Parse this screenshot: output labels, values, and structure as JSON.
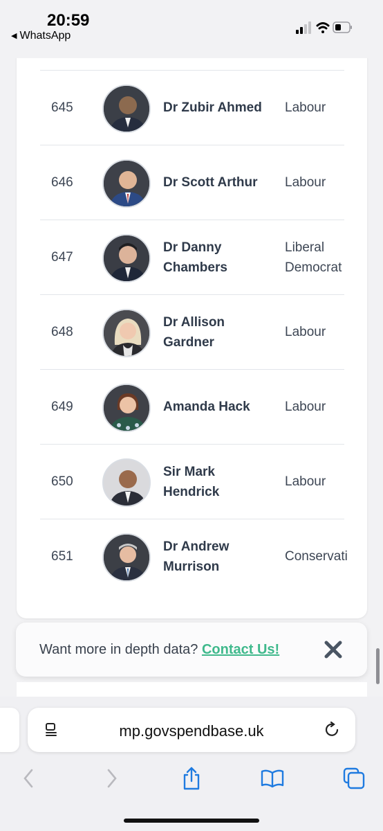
{
  "status_bar": {
    "time": "20:59",
    "back_app": "WhatsApp",
    "back_icon": "back-triangle-icon"
  },
  "table": {
    "rows": [
      {
        "rank": "645",
        "name": "Dr Zubir Ahmed",
        "party": "Labour"
      },
      {
        "rank": "646",
        "name": "Dr Scott Arthur",
        "party": "Labour"
      },
      {
        "rank": "647",
        "name": "Dr Danny Chambers",
        "party": "Liberal Democrat"
      },
      {
        "rank": "648",
        "name": "Dr Allison Gardner",
        "party": "Labour"
      },
      {
        "rank": "649",
        "name": "Amanda Hack",
        "party": "Labour"
      },
      {
        "rank": "650",
        "name": "Sir Mark Hendrick",
        "party": "Labour"
      },
      {
        "rank": "651",
        "name": "Dr Andrew Murrison",
        "party": "Conservative"
      }
    ]
  },
  "banner": {
    "text": "Want more in depth data?",
    "link_label": "Contact Us!",
    "link_color": "#3fb98c"
  },
  "browser": {
    "url": "mp.govspendbase.uk"
  }
}
